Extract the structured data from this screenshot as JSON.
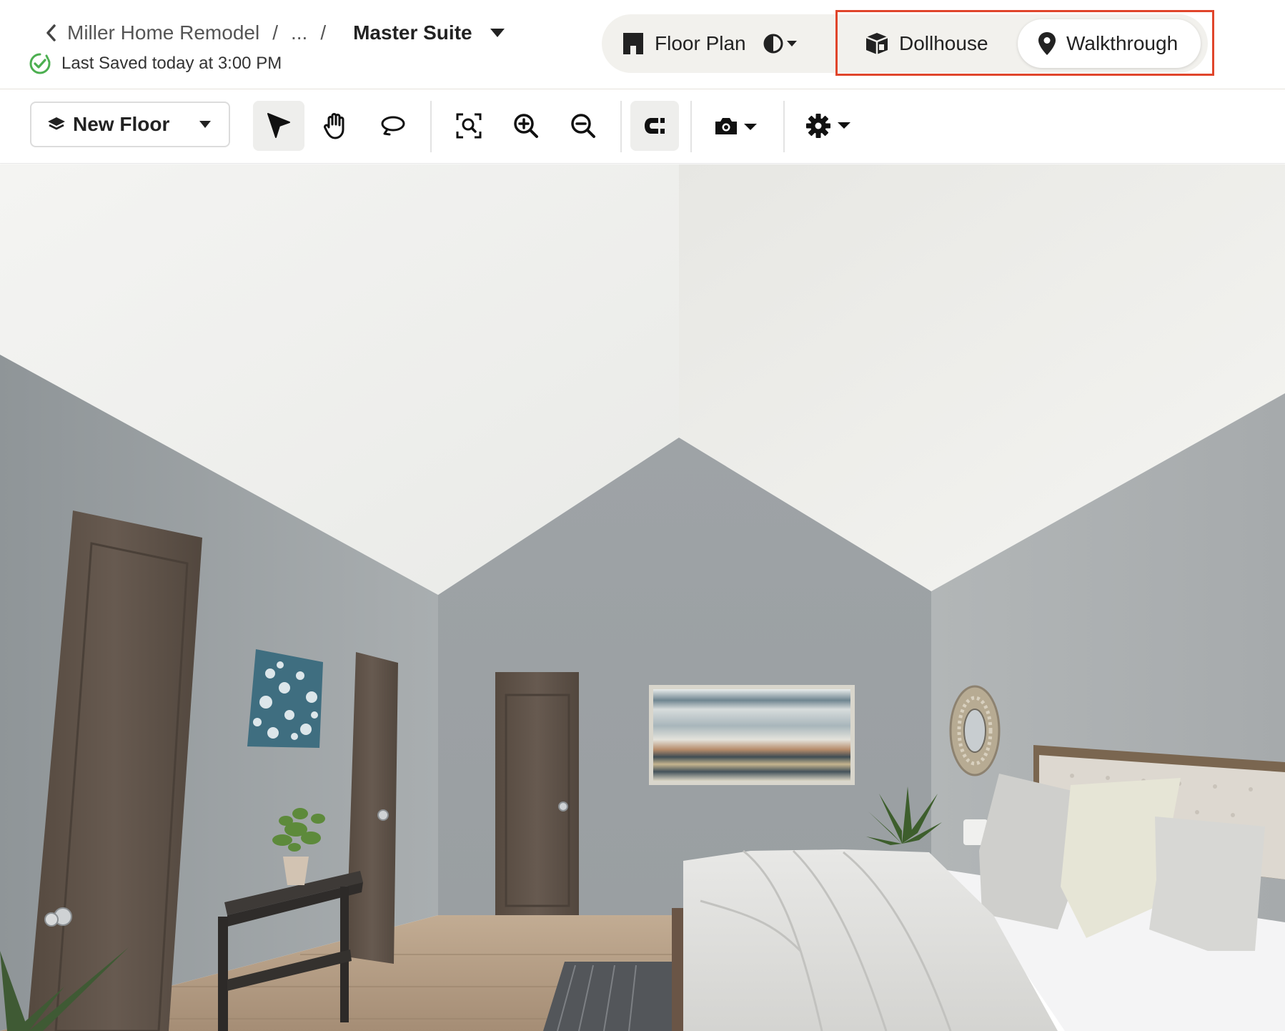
{
  "breadcrumb": {
    "project": "Miller Home Remodel",
    "ellipsis": "...",
    "separator": "/",
    "current": "Master Suite"
  },
  "save_status": "Last Saved today at 3:00 PM",
  "view_modes": {
    "floor_plan": "Floor Plan",
    "dollhouse": "Dollhouse",
    "walkthrough": "Walkthrough",
    "active": "Walkthrough"
  },
  "floor_select": {
    "value": "New Floor"
  },
  "toolbar_icons": [
    "select-arrow-icon",
    "pan-hand-icon",
    "rotate-icon",
    "zoom-fit-icon",
    "zoom-in-icon",
    "zoom-out-icon",
    "snap-magnet-icon",
    "camera-icon",
    "settings-gear-icon"
  ],
  "colors": {
    "accent_highlight": "#e0452b",
    "saved_check": "#4caf50",
    "wall": "#a3a8ab",
    "ceiling": "#f2f2ef",
    "floor": "#b7a28a",
    "door": "#5d524b"
  }
}
